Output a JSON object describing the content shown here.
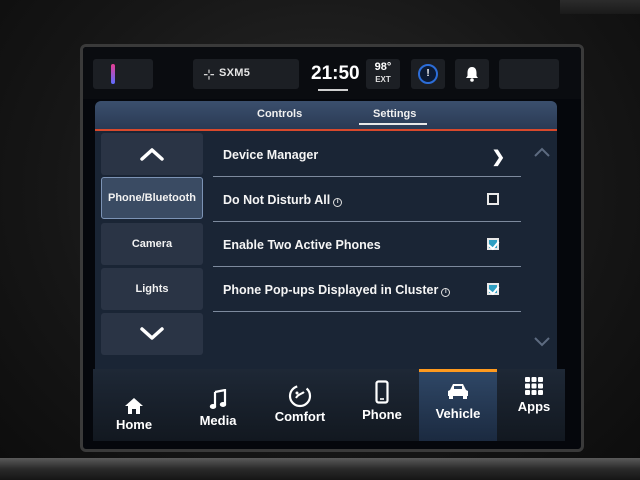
{
  "statusbar": {
    "source_label": "SXM5",
    "clock": "21:50",
    "temp": "98°",
    "temp_unit": "EXT",
    "icons": [
      "profile-indicator-icon",
      "satellite-icon",
      "ecall-icon",
      "bell-icon"
    ]
  },
  "tabs": {
    "controls": "Controls",
    "settings": "Settings",
    "active": "Settings"
  },
  "leftnav": {
    "up_icon": "chevron-up-icon",
    "items": [
      {
        "label": "Phone/Bluetooth",
        "active": true
      },
      {
        "label": "Camera",
        "active": false
      },
      {
        "label": "Lights",
        "active": false
      }
    ],
    "down_icon": "chevron-down-icon"
  },
  "settings_rows": [
    {
      "label": "Device Manager",
      "control": "chevron"
    },
    {
      "label": "Do Not Disturb All",
      "info": true,
      "control": "checkbox",
      "checked": false
    },
    {
      "label": "Enable Two Active Phones",
      "control": "checkbox",
      "checked": true
    },
    {
      "label": "Phone Pop-ups Displayed in Cluster",
      "info": true,
      "control": "checkbox",
      "checked": true
    }
  ],
  "info_glyph": "i",
  "bottomnav": {
    "active": "Vehicle",
    "items": [
      {
        "label": "Home",
        "icon": "home-icon"
      },
      {
        "label": "Media",
        "icon": "music-note-icon"
      },
      {
        "label": "Comfort",
        "icon": "comfort-icon"
      },
      {
        "label": "Phone",
        "icon": "phone-icon"
      },
      {
        "label": "Vehicle",
        "icon": "car-icon"
      },
      {
        "label": "Apps",
        "icon": "apps-grid-icon"
      }
    ]
  },
  "colors": {
    "accent_active_tab": "#ff9a1e",
    "tab_underline": "#d8492c",
    "checkbox_checked": "#2f9fc2"
  }
}
